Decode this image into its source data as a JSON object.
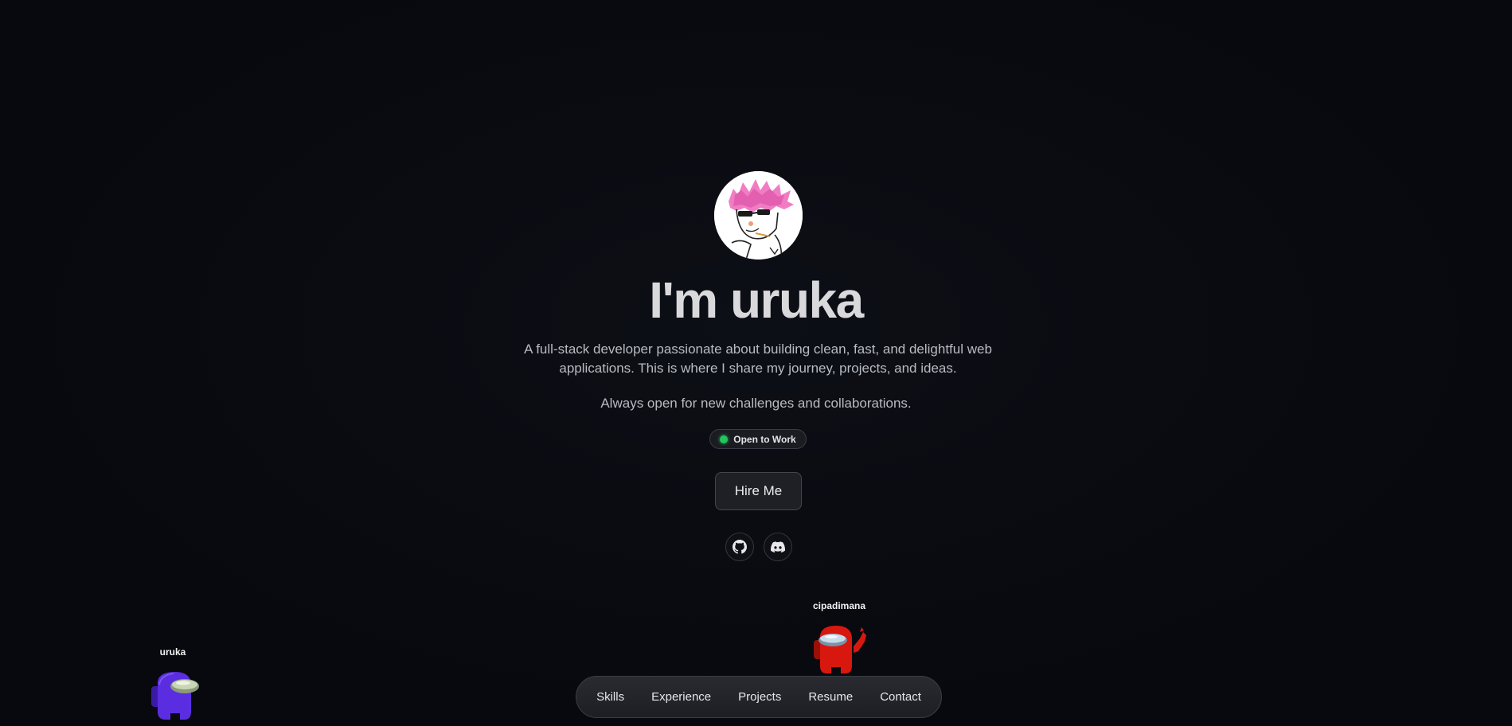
{
  "hero": {
    "title": "I'm uruka",
    "bio": "A full-stack developer passionate about building clean, fast, and delightful web applications. This is where I share my journey, projects, and ideas.",
    "tagline": "Always open for new challenges and collaborations.",
    "status_label": "Open to Work",
    "status_color": "#22c55e",
    "cta_label": "Hire Me"
  },
  "social": [
    {
      "icon": "github-icon"
    },
    {
      "icon": "discord-icon"
    }
  ],
  "players": [
    {
      "name": "uruka",
      "color": "#5b2de0"
    },
    {
      "name": "cipadimana",
      "color": "#d8180f"
    }
  ],
  "nav": {
    "items": [
      "Skills",
      "Experience",
      "Projects",
      "Resume",
      "Contact"
    ]
  }
}
